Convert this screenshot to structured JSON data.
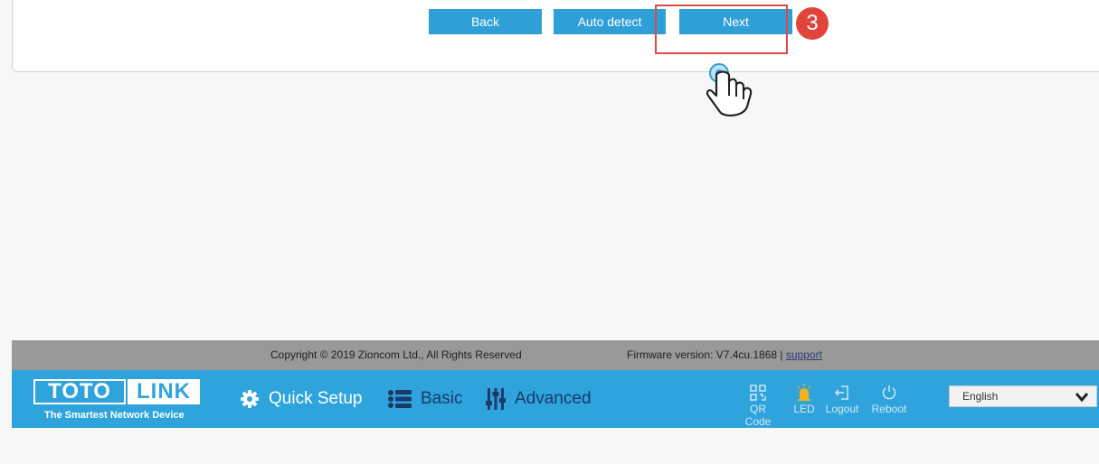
{
  "wizard": {
    "back_label": "Back",
    "auto_detect_label": "Auto detect",
    "next_label": "Next",
    "step_number": "3"
  },
  "footer": {
    "copyright": "Copyright © 2019 Zioncom Ltd., All Rights Reserved",
    "firmware": "Firmware version: V7.4cu.1868  |",
    "support_label": "support"
  },
  "navbar": {
    "logo_left": "TOTO",
    "logo_right": "LINK",
    "tagline": "The Smartest Network Device",
    "items": [
      {
        "label": "Quick Setup",
        "icon": "gear-icon"
      },
      {
        "label": "Basic",
        "icon": "list-icon"
      },
      {
        "label": "Advanced",
        "icon": "sliders-icon"
      }
    ],
    "utilities": [
      {
        "label": "QR Code",
        "icon": "qr-code-icon"
      },
      {
        "label": "LED",
        "icon": "led-icon"
      },
      {
        "label": "Logout",
        "icon": "logout-icon"
      },
      {
        "label": "Reboot",
        "icon": "power-icon"
      }
    ],
    "language": "English"
  },
  "colors": {
    "accent_blue": "#2fa4dc",
    "button_blue": "#2f9fd8",
    "highlight_red": "#e04848",
    "footer_gray": "#999999"
  }
}
